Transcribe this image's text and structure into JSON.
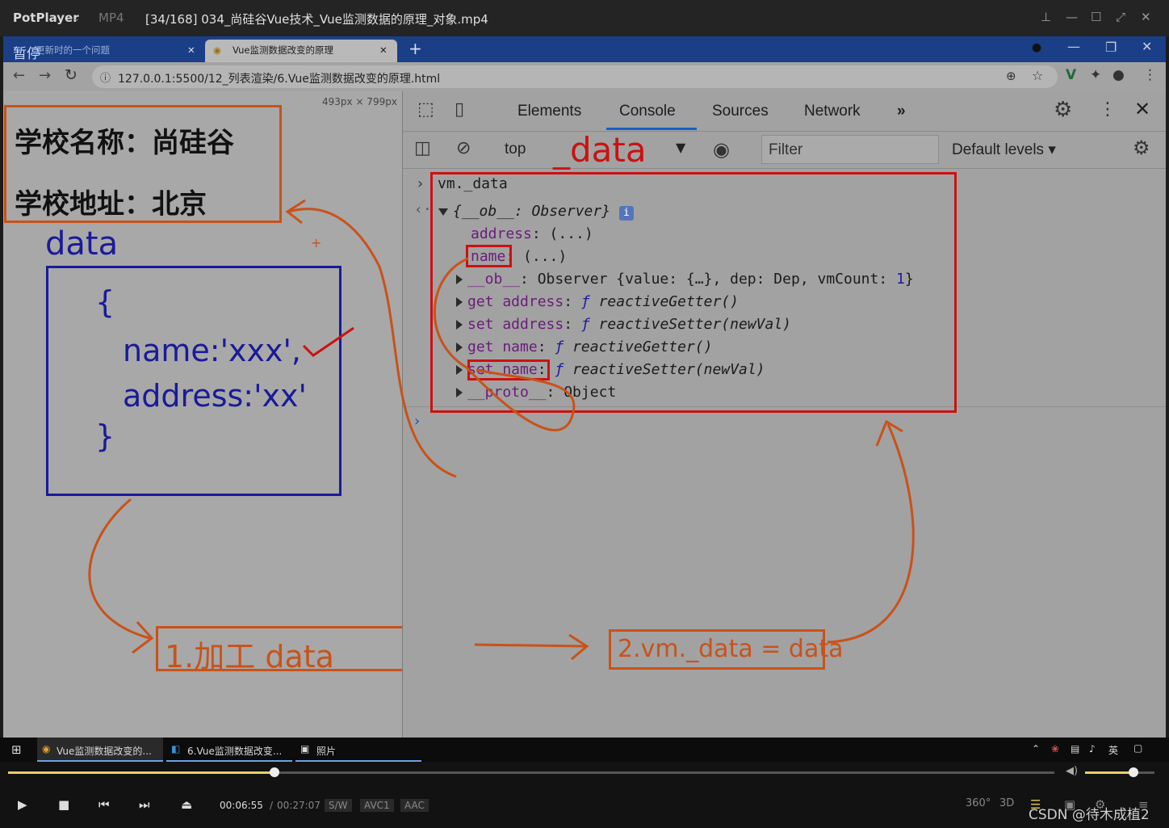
{
  "player": {
    "app_name": "PotPlayer",
    "format": "MP4",
    "title": "[34/168] 034_尚硅谷Vue技术_Vue监测数据的原理_对象.mp4"
  },
  "browser": {
    "pause_label": "暂停",
    "tabs": [
      {
        "label": "更新时的一个问题"
      },
      {
        "label": "Vue监测数据改变的原理"
      }
    ],
    "url": "127.0.0.1:5500/12_列表渲染/6.Vue监测数据改变的原理.html",
    "viewport_size": "493px × 799px"
  },
  "page": {
    "school_name": "学校名称：尚硅谷",
    "school_address": "学校地址：北京"
  },
  "devtools": {
    "tabs": [
      "Elements",
      "Console",
      "Sources",
      "Network"
    ],
    "active_tab": "Console",
    "more_tabs": "»",
    "context": "top",
    "filter_placeholder": "Filter",
    "levels": "Default levels ▾",
    "console": {
      "input": "vm._data",
      "output_head": "{__ob__: Observer}",
      "prop_address": "address",
      "prop_name": "name",
      "ellipsis": ": (...)",
      "ob_key": "__ob__",
      "ob_val": ": Observer {value: {…}, dep: Dep, vmCount: ",
      "ob_count": "1",
      "get_address": "get address",
      "set_address": "set address",
      "get_name": "get name",
      "set_name": "set name",
      "reactive_getter": "reactiveGetter()",
      "reactive_setter": "reactiveSetter(newVal)",
      "proto_key": "__proto__",
      "proto_val": ": Object"
    }
  },
  "annotations": {
    "data_label": "data",
    "devtools_data": "_data",
    "obj_open": "{",
    "obj_name": "name:'xxx',",
    "obj_address": "address:'xx'",
    "obj_close": "}",
    "step1": "1.加工 data",
    "step2": "2.vm._data = data",
    "plus": "+"
  },
  "taskbar": {
    "items": [
      "Vue监测数据改变的...",
      "6.Vue监测数据改变...",
      "照片"
    ],
    "ime": "英"
  },
  "controls": {
    "current_time": "00:06:55",
    "separator": "/",
    "total_time": "00:27:07",
    "tags": [
      "S/W",
      "AVC1",
      "AAC"
    ],
    "right_labels": [
      "360°",
      "3D"
    ],
    "progress": 0.255,
    "volume": 0.7,
    "watermark": "CSDN @待木成植2"
  },
  "colors": {
    "annotation_orange": "#c9521a",
    "annotation_red": "#cc1111",
    "annotation_blue": "#1a1a9a",
    "tabstrip_blue": "#1a3f86"
  }
}
